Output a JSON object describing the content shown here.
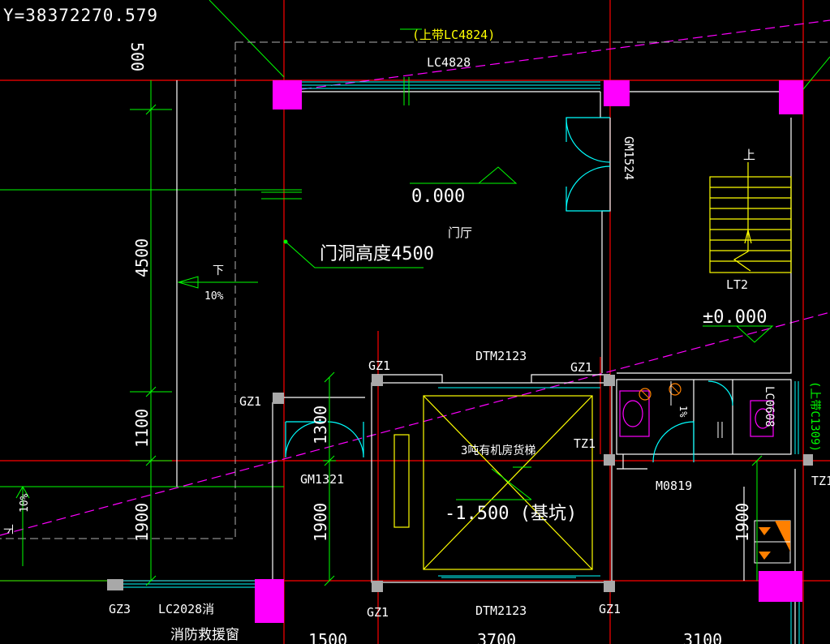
{
  "viewport": {
    "coordinate_readout": "Y=38372270.579"
  },
  "colors": {
    "background": "#000000",
    "axis_red": "#ff0000",
    "column_magenta": "#ff00ff",
    "wall_white": "#ffffff",
    "window_cyan": "#00ffff",
    "dim_green": "#00ff00",
    "stair_yellow": "#ffff00",
    "hatch_orange": "#ff8000",
    "guide_magenta_dashed": "#ff00ff",
    "column_gray": "#a0a0a0"
  },
  "labels": {
    "window_top_alt": "(上带LC4824)",
    "window_top": "LC4828",
    "door_right": "GM1524",
    "elevation_lobby": "0.000",
    "room_lobby": "门厅",
    "door_opening_height": "门洞高度4500",
    "slope_left_dir": "下",
    "slope_left_pct": "10%",
    "slope_far_left_dir": "下",
    "slope_far_left_pct": "10%",
    "stair_up": "上",
    "stair_name": "LT2",
    "elevation_stair": "±0.000",
    "elevator_door_top": "DTM2123",
    "elevator_door_bottom": "DTM2123",
    "column_gz1_a": "GZ1",
    "column_gz1_b": "GZ1",
    "column_gz1_c": "GZ1",
    "column_gz1_d": "GZ1",
    "column_gz1_e": "GZ1",
    "column_gz3": "GZ3",
    "column_tz1_a": "TZ1",
    "column_tz1_b": "TZ1",
    "elevator_name": "3吨有机房货梯",
    "elevator_pit": "-1.500 (基坑)",
    "door_left": "GM1321",
    "door_toilet": "M0819",
    "window_toilet": "LC0608",
    "window_right_alt": "(上带C1309)",
    "toilet_slope": "1%",
    "window_bottom": "LC2028消",
    "rescue_window": "消防救援窗"
  },
  "dimensions": {
    "left_500": "500",
    "left_4500": "4500",
    "left_1100": "1100",
    "left_1900": "1900",
    "mid_1300": "1300",
    "mid_1900": "1900",
    "right_1900": "1900",
    "bottom_1500": "1500",
    "bottom_3700": "3700",
    "bottom_3100": "3100"
  }
}
